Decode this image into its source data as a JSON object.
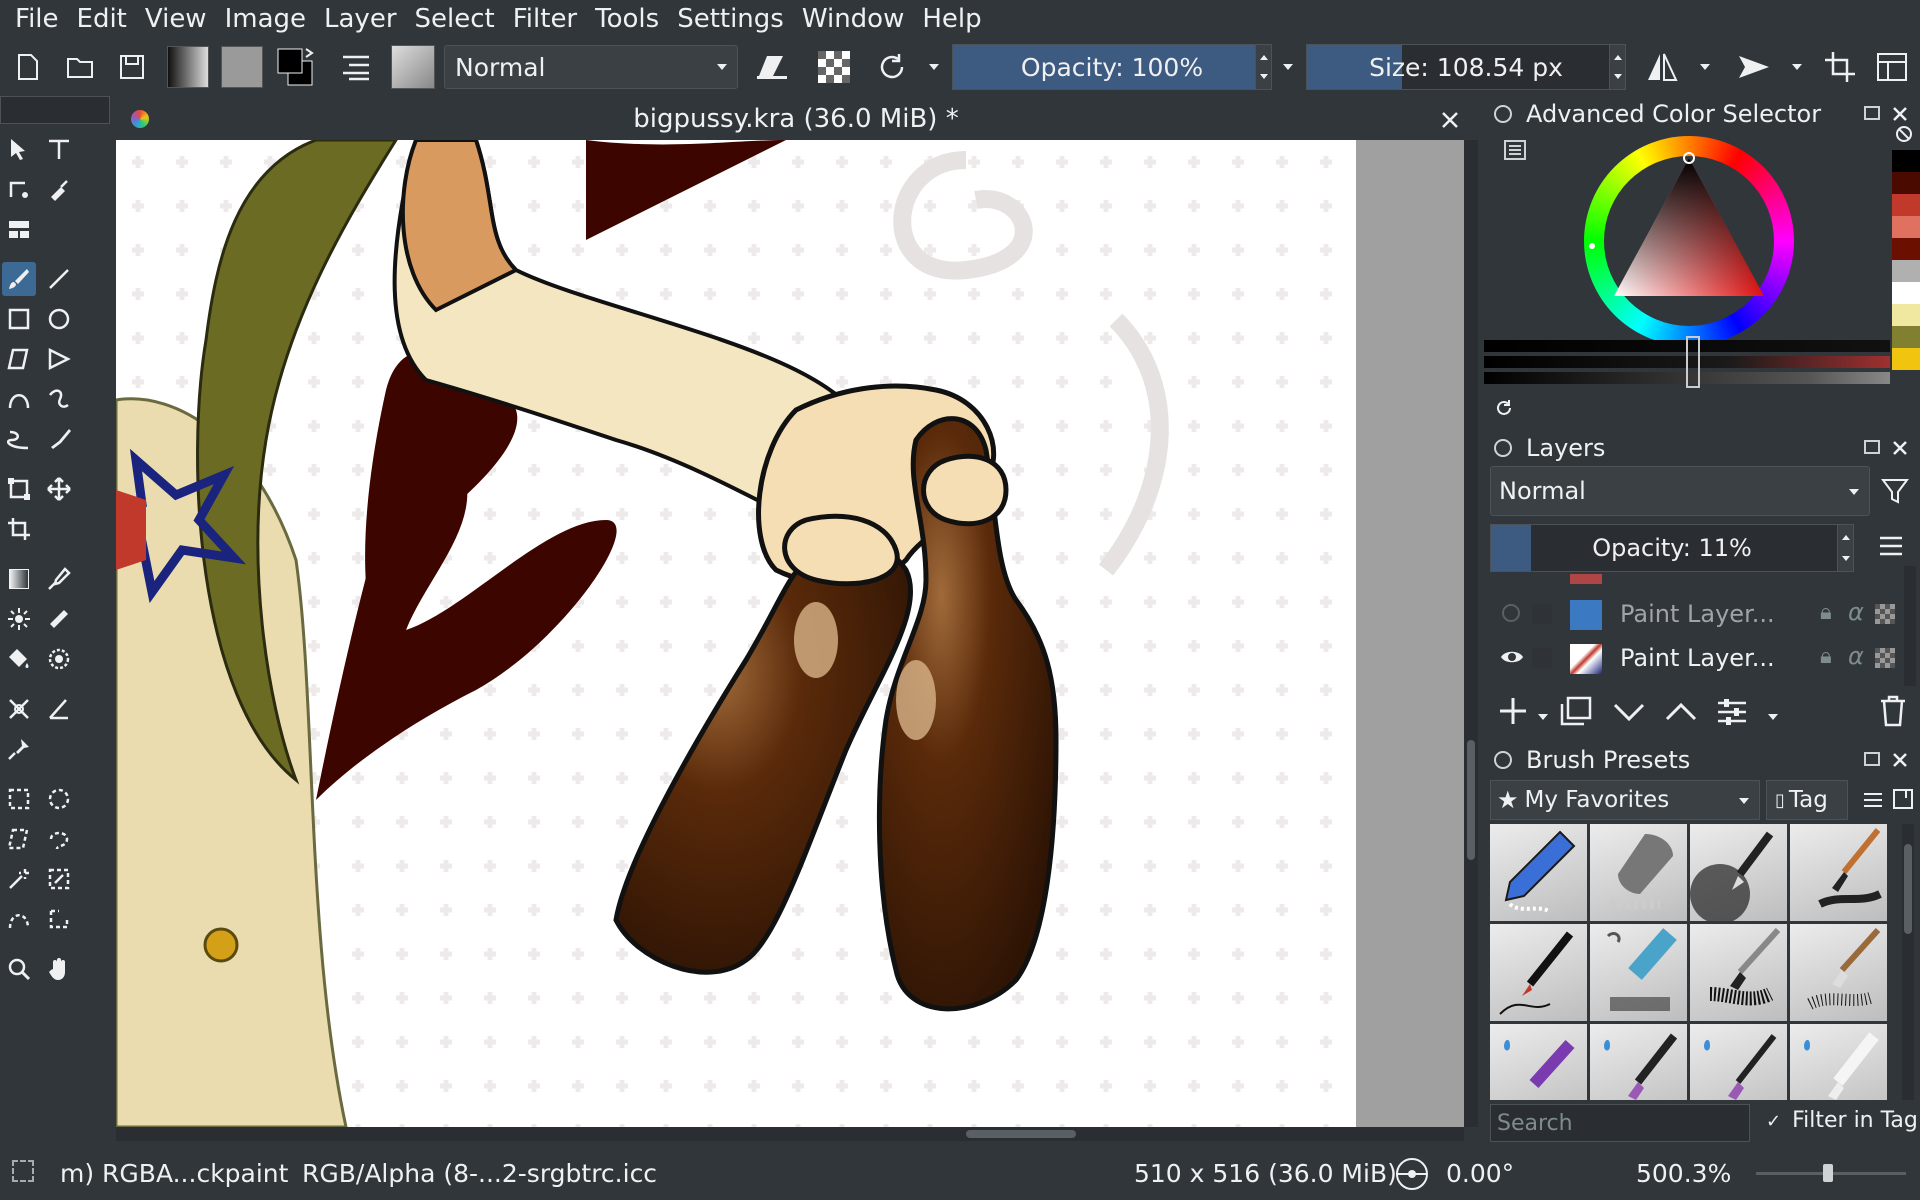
{
  "menu": [
    "File",
    "Edit",
    "View",
    "Image",
    "Layer",
    "Select",
    "Filter",
    "Tools",
    "Settings",
    "Window",
    "Help"
  ],
  "toolbar": {
    "blend_mode": "Normal",
    "opacity_label": "Opacity: 100%",
    "opacity_value": 1.0,
    "size_label": "Size: 108.54 px"
  },
  "document": {
    "tab_title": "bigpussy.kra (36.0 MiB) *"
  },
  "dockers": {
    "color_selector": {
      "title": "Advanced Color Selector"
    },
    "layers": {
      "title": "Layers",
      "blend_mode": "Normal",
      "opacity_label": "Opacity: 11%",
      "opacity_value": 0.11,
      "items": [
        {
          "name": "Paint Layer...",
          "visible": false
        },
        {
          "name": "Paint Layer...",
          "visible": true
        }
      ]
    },
    "brush_presets": {
      "title": "Brush Presets",
      "tag": "My Favorites",
      "tag_button": "Tag",
      "search_placeholder": "Search",
      "filter_in_tag": "Filter in Tag"
    }
  },
  "statusbar": {
    "layer_info": "m) RGBA...ckpaint",
    "color_profile": "RGB/Alpha (8-...2-srgbtrc.icc",
    "image_size": "510 x 516 (36.0 MiB)",
    "rotation": "0.00°",
    "zoom": "500.3%"
  },
  "colors": {
    "accent": "#3d5a80",
    "background": "#31363b",
    "swatches": [
      "#000000",
      "#4a0a00",
      "#c0392b",
      "#e07060",
      "#6b0f00",
      "#b0b0b0",
      "#ffffff",
      "#f0e8a0",
      "#808030",
      "#f1c40f"
    ]
  }
}
